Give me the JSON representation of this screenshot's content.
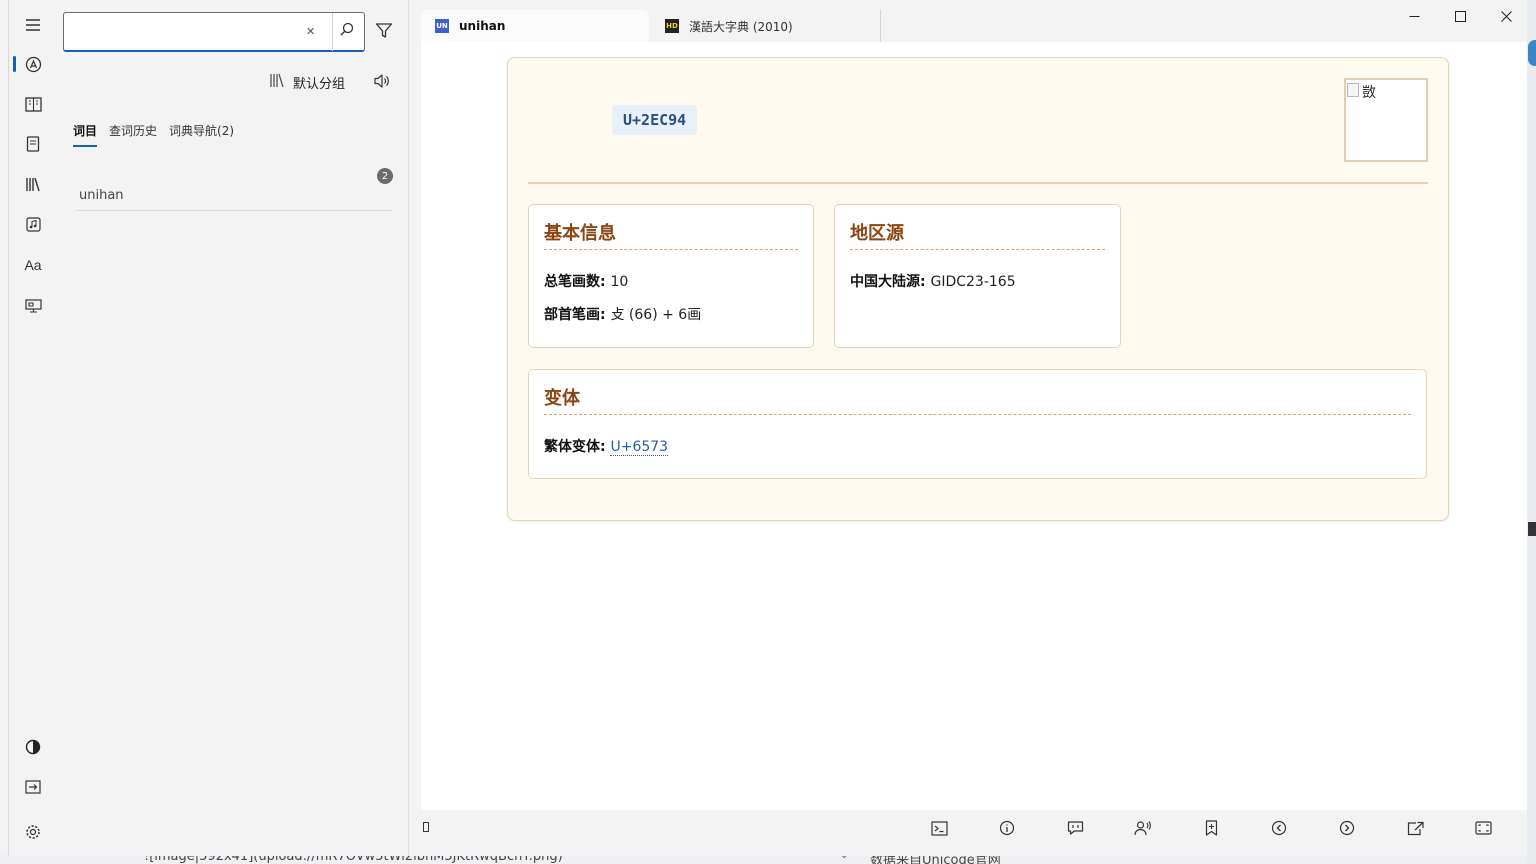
{
  "app": {
    "rail": {
      "items": [
        "menu-icon",
        "lookup-icon",
        "dictionaries-icon",
        "wordbook-icon",
        "library-icon",
        "audio-icon",
        "font-icon",
        "screen-capture-icon",
        "theme-icon",
        "export-icon",
        "settings-icon"
      ],
      "active": "lookup-icon"
    },
    "search": {
      "value": "𮺔",
      "placeholder": ""
    },
    "group_label": "默认分组",
    "tabs": [
      {
        "label": "词目"
      },
      {
        "label": "查词历史"
      },
      {
        "label": "词典导航(2)"
      }
    ],
    "entry": {
      "headword": "𮺔",
      "source": "unihan",
      "count": "2"
    }
  },
  "content": {
    "tabs": [
      {
        "label": "unihan",
        "favicon": "UN"
      },
      {
        "label": "漢語大字典 (2010)",
        "favicon": "HD"
      }
    ],
    "card": {
      "character": "𮺔",
      "codepoint": "U+2EC94",
      "image_alt": "敳",
      "basic": {
        "heading": "基本信息",
        "total_strokes_label": "总笔画数",
        "total_strokes": "10",
        "radical_label": "部首笔画",
        "radical": "攴 (66) + 6画"
      },
      "region": {
        "heading": "地区源",
        "mainland_label": "中国大陆源",
        "mainland": "GIDC23-165"
      },
      "variants": {
        "heading": "变体",
        "traditional_label": "繁体变体",
        "traditional": "U+6573"
      }
    },
    "toolbar": [
      "terminal-icon",
      "info-icon",
      "comment-icon",
      "voice-icon",
      "bookmark-icon",
      "back-icon",
      "forward-icon",
      "open-external-icon",
      "fullscreen-icon"
    ]
  },
  "underlying": {
    "left_text": "![image|592x41](upload://mR7OVw5tWi2ibnM5JKtRwqBcnT.png)",
    "right_text": "数据来自Unicode官网"
  },
  "colors": {
    "accent": "#1a5fb4",
    "heading_brown": "#8b4513",
    "card_bg": "#fffaf0",
    "codepoint_bg": "#e8f0f8",
    "link": "#2a5db0"
  }
}
